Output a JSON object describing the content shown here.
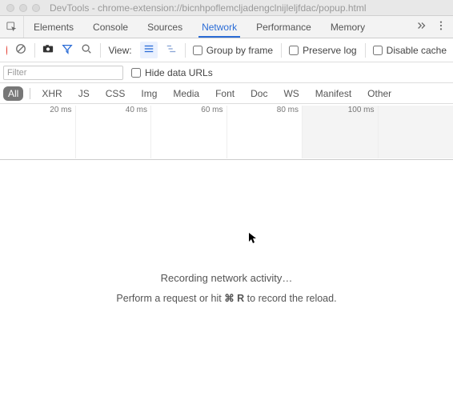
{
  "window": {
    "title": "DevTools - chrome-extension://bicnhpoflemcljadengclnijleljfdac/popup.html"
  },
  "tabs": {
    "items": [
      {
        "label": "Elements"
      },
      {
        "label": "Console"
      },
      {
        "label": "Sources"
      },
      {
        "label": "Network",
        "active": true
      },
      {
        "label": "Performance"
      },
      {
        "label": "Memory"
      }
    ]
  },
  "toolbar": {
    "view_label": "View:",
    "group_by_frame": "Group by frame",
    "preserve_log": "Preserve log",
    "disable_cache": "Disable cache"
  },
  "filter": {
    "placeholder": "Filter",
    "hide_data_urls": "Hide data URLs"
  },
  "types": {
    "items": [
      {
        "label": "All",
        "active": true
      },
      {
        "label": "XHR"
      },
      {
        "label": "JS"
      },
      {
        "label": "CSS"
      },
      {
        "label": "Img"
      },
      {
        "label": "Media"
      },
      {
        "label": "Font"
      },
      {
        "label": "Doc"
      },
      {
        "label": "WS"
      },
      {
        "label": "Manifest"
      },
      {
        "label": "Other"
      }
    ]
  },
  "timeline": {
    "labels": [
      "20 ms",
      "40 ms",
      "60 ms",
      "80 ms",
      "100 ms"
    ]
  },
  "empty": {
    "line1": "Recording network activity…",
    "line2_pre": "Perform a request or hit ",
    "line2_kbd": "⌘ R",
    "line2_post": " to record the reload."
  }
}
